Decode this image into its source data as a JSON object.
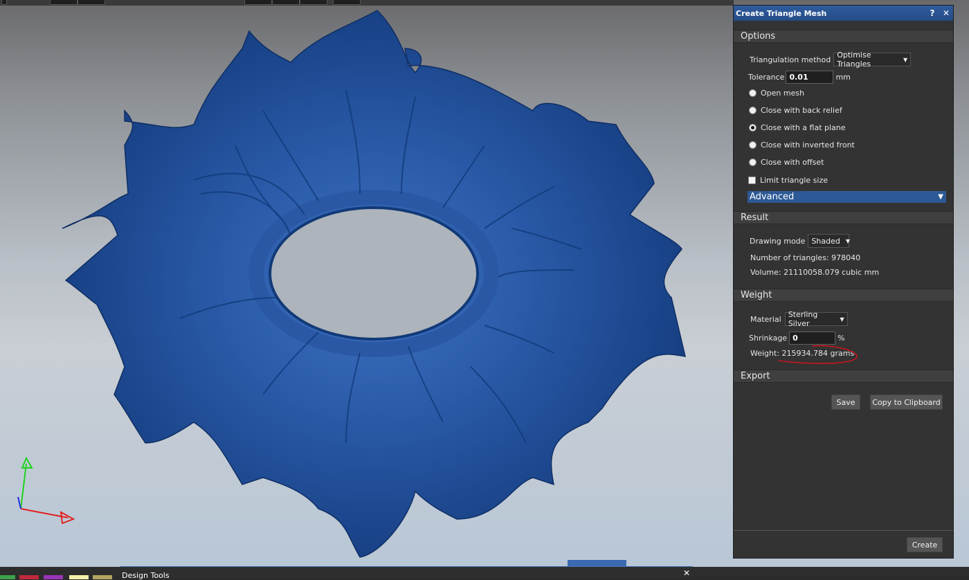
{
  "panel": {
    "title": "Create Triangle Mesh",
    "help_icon": "?",
    "close_icon": "✕",
    "options": {
      "heading": "Options",
      "triangulation_label": "Triangulation method",
      "triangulation_value": "Optimise Triangles",
      "tolerance_label": "Tolerance",
      "tolerance_value": "0.01",
      "tolerance_unit": "mm",
      "radios": [
        {
          "label": "Open mesh",
          "selected": false
        },
        {
          "label": "Close with back relief",
          "selected": false
        },
        {
          "label": "Close with a flat plane",
          "selected": true
        },
        {
          "label": "Close with inverted front",
          "selected": false
        },
        {
          "label": "Close with offset",
          "selected": false
        }
      ],
      "limit_label": "Limit triangle size",
      "advanced_label": "Advanced"
    },
    "result": {
      "heading": "Result",
      "drawing_mode_label": "Drawing mode",
      "drawing_mode_value": "Shaded",
      "triangles_text": "Number of triangles: 978040",
      "volume_text": "Volume: 21110058.079 cubic mm"
    },
    "weight": {
      "heading": "Weight",
      "material_label": "Material",
      "material_value": "Sterling Silver",
      "shrinkage_label": "Shrinkage",
      "shrinkage_value": "0",
      "shrinkage_unit": "%",
      "weight_text": "Weight: 215934.784 grams"
    },
    "export": {
      "heading": "Export",
      "save_label": "Save",
      "clipboard_label": "Copy to Clipboard"
    },
    "create_label": "Create"
  },
  "bottom": {
    "design_tools_title": "Design Tools",
    "close_icon": "✕"
  },
  "colors": {
    "model_blue": "#1f4f9a",
    "panel_bg": "#333333",
    "title_blue": "#2b5797",
    "annotation_red": "#d0141e"
  }
}
